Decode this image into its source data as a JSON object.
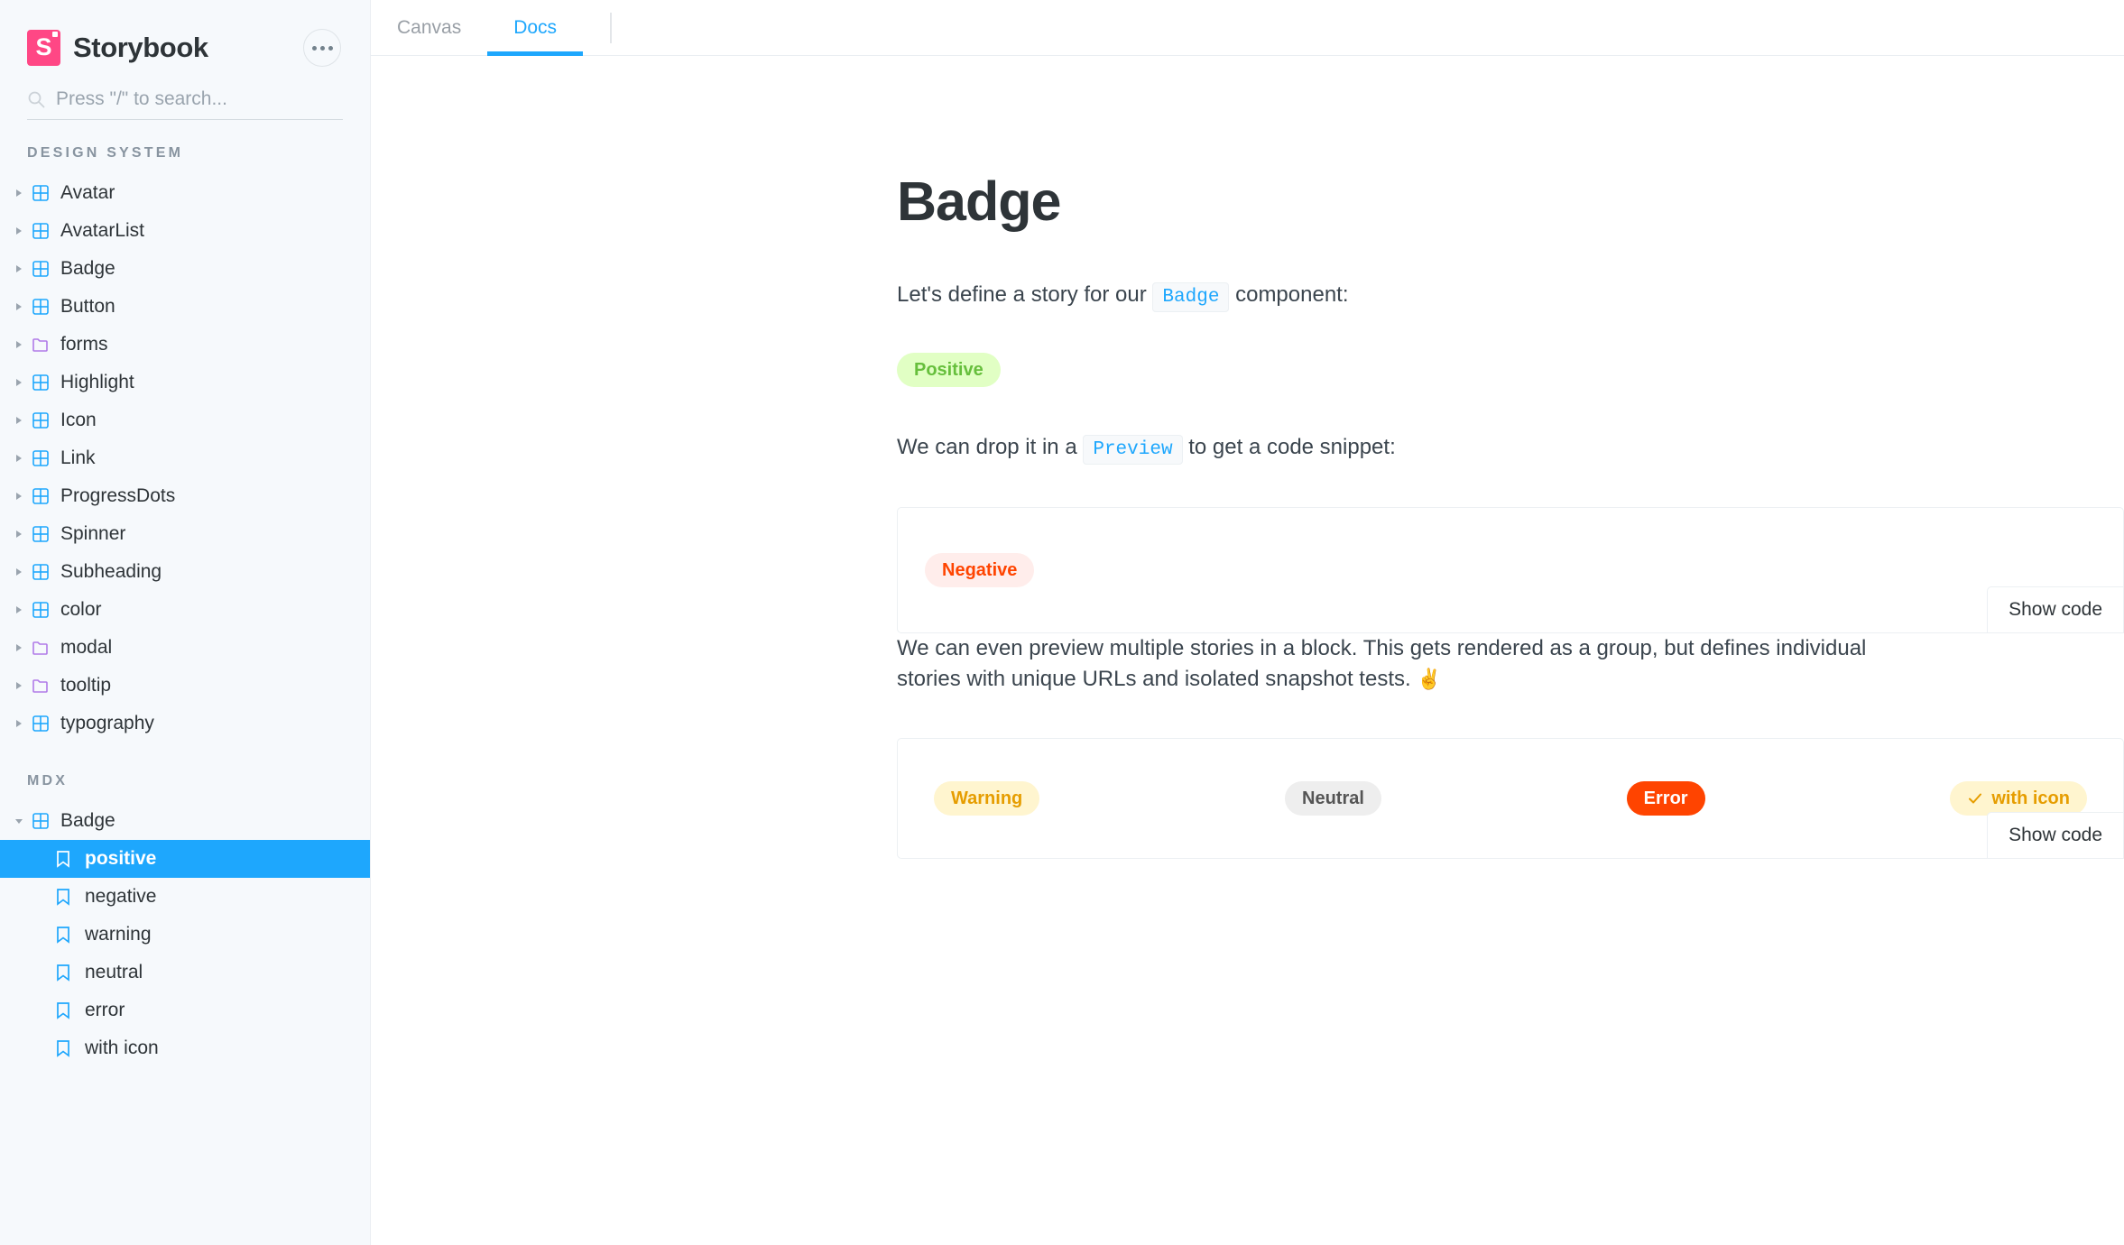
{
  "brand": {
    "name": "Storybook",
    "logo_glyph": "S",
    "menu_label": "•••"
  },
  "search": {
    "placeholder": "Press \"/\" to search...",
    "value": ""
  },
  "sidebar": {
    "sections": [
      {
        "heading": "DESIGN SYSTEM",
        "items": [
          {
            "label": "Avatar",
            "icon": "component-icon",
            "expanded": false
          },
          {
            "label": "AvatarList",
            "icon": "component-icon",
            "expanded": false
          },
          {
            "label": "Badge",
            "icon": "component-icon",
            "expanded": false
          },
          {
            "label": "Button",
            "icon": "component-icon",
            "expanded": false
          },
          {
            "label": "forms",
            "icon": "folder-icon",
            "expanded": false
          },
          {
            "label": "Highlight",
            "icon": "component-icon",
            "expanded": false
          },
          {
            "label": "Icon",
            "icon": "component-icon",
            "expanded": false
          },
          {
            "label": "Link",
            "icon": "component-icon",
            "expanded": false
          },
          {
            "label": "ProgressDots",
            "icon": "component-icon",
            "expanded": false
          },
          {
            "label": "Spinner",
            "icon": "component-icon",
            "expanded": false
          },
          {
            "label": "Subheading",
            "icon": "component-icon",
            "expanded": false
          },
          {
            "label": "color",
            "icon": "component-icon",
            "expanded": false
          },
          {
            "label": "modal",
            "icon": "folder-icon",
            "expanded": false
          },
          {
            "label": "tooltip",
            "icon": "folder-icon",
            "expanded": false
          },
          {
            "label": "typography",
            "icon": "component-icon",
            "expanded": false
          }
        ]
      },
      {
        "heading": "MDX",
        "items": [
          {
            "label": "Badge",
            "icon": "component-icon",
            "expanded": true
          }
        ],
        "stories": [
          {
            "label": "positive",
            "icon": "story-icon",
            "selected": true
          },
          {
            "label": "negative",
            "icon": "story-icon",
            "selected": false
          },
          {
            "label": "warning",
            "icon": "story-icon",
            "selected": false
          },
          {
            "label": "neutral",
            "icon": "story-icon",
            "selected": false
          },
          {
            "label": "error",
            "icon": "story-icon",
            "selected": false
          },
          {
            "label": "with icon",
            "icon": "story-icon",
            "selected": false
          }
        ]
      }
    ]
  },
  "toolbar": {
    "tabs": [
      {
        "label": "Canvas",
        "active": false
      },
      {
        "label": "Docs",
        "active": true
      }
    ]
  },
  "doc": {
    "title": "Badge",
    "p1_before": "Let's define a story for our",
    "p1_code": "Badge",
    "p1_after": "component:",
    "p2_before": "We can drop it in a",
    "p2_code": "Preview",
    "p2_after": "to get a code snippet:",
    "p3": "We can even preview multiple stories in a block. This gets rendered as a group, but defines individual stories with unique URLs and isolated snapshot tests.",
    "p3_emoji": "✌️",
    "badge_positive": "Positive",
    "preview1": {
      "badge": "Negative",
      "show_code_label": "Show code"
    },
    "preview2": {
      "badges": [
        {
          "label": "Warning",
          "variant": "warning",
          "icon": null
        },
        {
          "label": "Neutral",
          "variant": "neutral",
          "icon": null
        },
        {
          "label": "Error",
          "variant": "error",
          "icon": null
        },
        {
          "label": "with icon",
          "variant": "withicon",
          "icon": "check-icon"
        }
      ],
      "show_code_label": "Show code"
    }
  },
  "colors": {
    "accent": "#1ea7fd",
    "brand_pink": "#ff4785",
    "positive_bg": "#e1ffc4",
    "positive_fg": "#66bf3c",
    "negative_bg": "#ffedeb",
    "negative_fg": "#ff4400",
    "warning_bg": "#fff5cf",
    "warning_fg": "#e69d00",
    "neutral_bg": "#eeeeee",
    "neutral_fg": "#555555",
    "error_bg": "#ff4400",
    "error_fg": "#ffffff",
    "sidebar_bg": "#f6f9fc"
  }
}
